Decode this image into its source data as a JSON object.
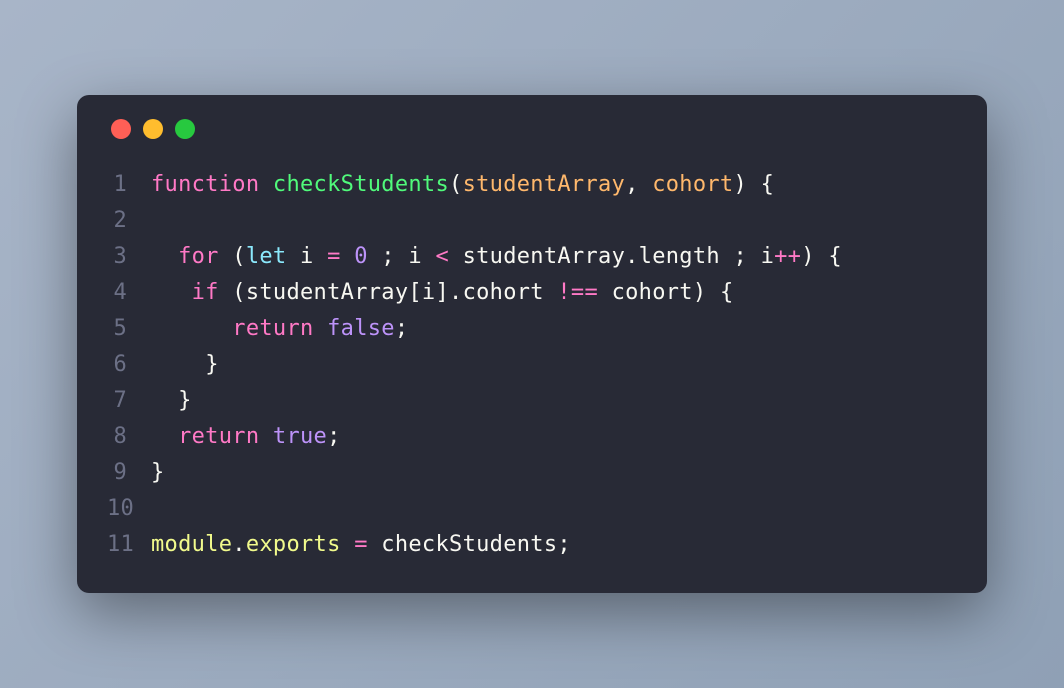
{
  "trafficLights": {
    "red": "#ff5f56",
    "yellow": "#ffbd2e",
    "green": "#27c93f"
  },
  "lines": [
    {
      "num": "1"
    },
    {
      "num": "2"
    },
    {
      "num": "3"
    },
    {
      "num": "4"
    },
    {
      "num": "5"
    },
    {
      "num": "6"
    },
    {
      "num": "7"
    },
    {
      "num": "8"
    },
    {
      "num": "9"
    },
    {
      "num": "10"
    },
    {
      "num": "11"
    }
  ],
  "tokens": {
    "l1": {
      "function": "function",
      "sp1": " ",
      "checkStudents": "checkStudents",
      "lparen": "(",
      "studentArray": "studentArray",
      "comma": ",",
      "sp2": " ",
      "cohort": "cohort",
      "rparen": ")",
      "sp3": " ",
      "lbrace": "{"
    },
    "l2": {
      "blank": ""
    },
    "l3": {
      "ind": "  ",
      "for": "for",
      "sp1": " ",
      "lparen": "(",
      "let": "let",
      "sp2": " ",
      "i": "i",
      "sp3": " ",
      "eq": "=",
      "sp4": " ",
      "zero": "0",
      "sp5": " ",
      "semi1": ";",
      "sp6": " ",
      "i2": "i",
      "sp7": " ",
      "lt": "<",
      "sp8": " ",
      "studentArray": "studentArray",
      "dot": ".",
      "length": "length",
      "sp9": " ",
      "semi2": ";",
      "sp10": " ",
      "i3": "i",
      "pp": "++",
      "rparen": ")",
      "sp11": " ",
      "lbrace": "{"
    },
    "l4": {
      "ind": "   ",
      "if": "if",
      "sp1": " ",
      "lparen": "(",
      "studentArray": "studentArray",
      "lbrack": "[",
      "i": "i",
      "rbrack": "]",
      "dot": ".",
      "cohort": "cohort",
      "sp2": " ",
      "neq": "!==",
      "sp3": " ",
      "cohort2": "cohort",
      "rparen": ")",
      "sp4": " ",
      "lbrace": "{"
    },
    "l5": {
      "ind": "      ",
      "return": "return",
      "sp1": " ",
      "false": "false",
      "semi": ";"
    },
    "l6": {
      "ind": "    ",
      "rbrace": "}"
    },
    "l7": {
      "ind": "  ",
      "rbrace": "}"
    },
    "l8": {
      "ind": "  ",
      "return": "return",
      "sp1": " ",
      "true": "true",
      "semi": ";"
    },
    "l9": {
      "rbrace": "}"
    },
    "l10": {
      "blank": ""
    },
    "l11": {
      "module": "module",
      "dot": ".",
      "exports": "exports",
      "sp1": " ",
      "eq": "=",
      "sp2": " ",
      "checkStudents": "checkStudents",
      "semi": ";"
    }
  }
}
